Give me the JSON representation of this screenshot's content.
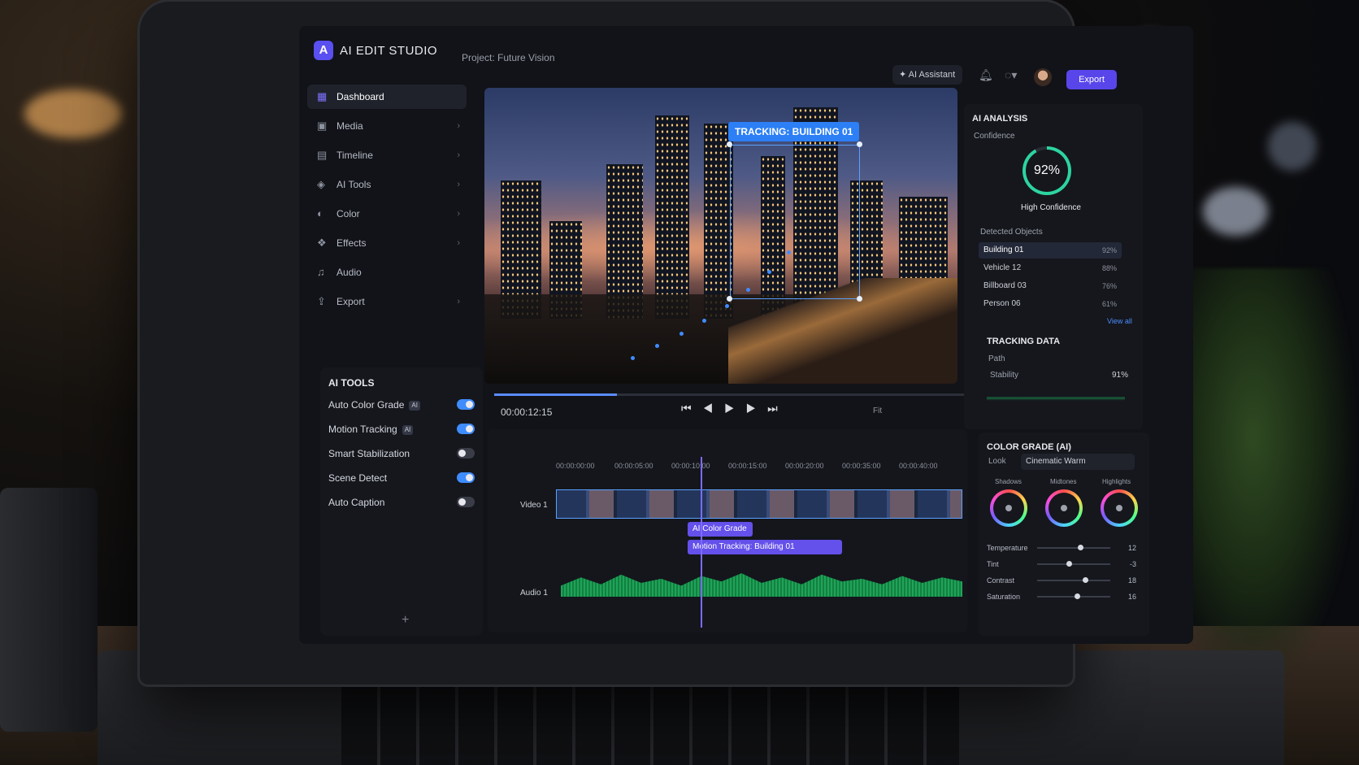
{
  "app": {
    "logo_letter": "A",
    "title": "AI EDIT STUDIO",
    "project": "Project: Future Vision",
    "ai_assistant": "AI Assistant",
    "export": "Export"
  },
  "sidebar": {
    "items": [
      {
        "label": "Dashboard",
        "icon": "dashboard-icon"
      },
      {
        "label": "Media",
        "icon": "media-icon"
      },
      {
        "label": "Timeline",
        "icon": "timeline-icon"
      },
      {
        "label": "AI Tools",
        "icon": "ai-tools-icon"
      },
      {
        "label": "Color",
        "icon": "color-icon"
      },
      {
        "label": "Effects",
        "icon": "effects-icon"
      },
      {
        "label": "Audio",
        "icon": "audio-icon"
      },
      {
        "label": "Export",
        "icon": "export-icon"
      }
    ]
  },
  "ai_tools": {
    "title": "AI TOOLS",
    "badge": "AI",
    "items": [
      {
        "label": "Auto Color Grade",
        "ai": true,
        "on": true
      },
      {
        "label": "Motion Tracking",
        "ai": true,
        "on": true
      },
      {
        "label": "Smart Stabilization",
        "ai": false,
        "on": false
      },
      {
        "label": "Scene Detect",
        "ai": false,
        "on": true
      },
      {
        "label": "Auto Caption",
        "ai": false,
        "on": false
      }
    ]
  },
  "preview": {
    "tracking_label": "TRACKING: BUILDING 01",
    "timecode": "00:00:12:15",
    "progress": 0.26,
    "fit": "Fit"
  },
  "timeline": {
    "ruler": [
      "00:00:00:00",
      "00:00:05:00",
      "00:00:10:00",
      "00:00:15:00",
      "00:00:20:00",
      "00:00:35:00",
      "00:00:40:00"
    ],
    "tracks": {
      "video": "Video 1",
      "audio": "Audio 1"
    },
    "clips": {
      "color_grade": "AI Color Grade",
      "motion": "Motion Tracking: Building 01"
    }
  },
  "analysis": {
    "title": "AI ANALYSIS",
    "confidence_label": "Confidence",
    "confidence_value": "92%",
    "confidence_fraction": 0.92,
    "confidence_text": "High Confidence",
    "detected_title": "Detected Objects",
    "objects": [
      {
        "name": "Building 01",
        "pct": "92%"
      },
      {
        "name": "Vehicle 12",
        "pct": "88%"
      },
      {
        "name": "Billboard 03",
        "pct": "76%"
      },
      {
        "name": "Person 06",
        "pct": "61%"
      }
    ],
    "view_all": "View all",
    "tracking_title": "TRACKING DATA",
    "path_label": "Path",
    "stability_label": "Stability",
    "stability_value": "91%"
  },
  "color_grade": {
    "title": "COLOR GRADE (AI)",
    "look_label": "Look",
    "look_value": "Cinematic Warm",
    "wheels": [
      "Shadows",
      "Midtones",
      "Highlights"
    ],
    "sliders": [
      {
        "label": "Temperature",
        "value": "12"
      },
      {
        "label": "Tint",
        "value": "-3"
      },
      {
        "label": "Contrast",
        "value": "18"
      },
      {
        "label": "Saturation",
        "value": "16"
      }
    ]
  }
}
